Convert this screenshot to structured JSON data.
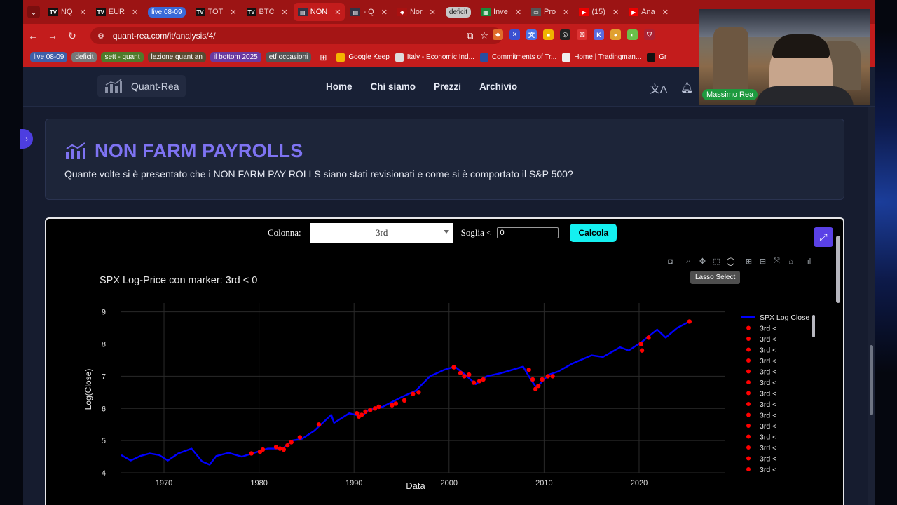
{
  "tabs": [
    {
      "fav": "TV",
      "favcolor": "#111",
      "title": "NQ",
      "pill": false
    },
    {
      "fav": "TV",
      "favcolor": "#111",
      "title": "EUR",
      "pill": false
    },
    {
      "fav": "",
      "favcolor": "",
      "title": "live 08-09",
      "pill": true,
      "pillcolor": "#3a6ad8"
    },
    {
      "fav": "TV",
      "favcolor": "#111",
      "title": "TOT",
      "pill": false
    },
    {
      "fav": "TV",
      "favcolor": "#111",
      "title": "BTC",
      "pill": false
    },
    {
      "fav": "▤",
      "favcolor": "#334",
      "title": "NON",
      "pill": false,
      "active": true
    },
    {
      "fav": "▤",
      "favcolor": "#334",
      "title": "- Q",
      "pill": false
    },
    {
      "fav": "◆",
      "favcolor": "#a11",
      "title": "Nor",
      "pill": false
    },
    {
      "fav": "",
      "favcolor": "",
      "title": "deficit",
      "pill": true,
      "pillcolor": "#c8c8c8"
    },
    {
      "fav": "▦",
      "favcolor": "#1a8a3a",
      "title": "Inve",
      "pill": false
    },
    {
      "fav": "▭",
      "favcolor": "#555",
      "title": "Pro",
      "pill": false
    },
    {
      "fav": "▶",
      "favcolor": "#e00",
      "title": "(15)",
      "pill": false
    },
    {
      "fav": "▶",
      "favcolor": "#e00",
      "title": "Ana",
      "pill": false
    }
  ],
  "address": {
    "url": "quant-rea.com/it/analysis/4/"
  },
  "bookmarks": {
    "pills": [
      {
        "label": "live 08-09",
        "color": "#3f5fa8"
      },
      {
        "label": "deficit",
        "color": "#777"
      },
      {
        "label": "sett - quant",
        "color": "#4f7a2a"
      },
      {
        "label": "lezione quant an",
        "color": "#5a4a30"
      },
      {
        "label": "il bottom 2025",
        "color": "#6a3aa0"
      },
      {
        "label": "etf occasioni",
        "color": "#555"
      }
    ],
    "links": [
      {
        "label": "Google Keep",
        "color": "#f5b400"
      },
      {
        "label": "Italy - Economic Ind...",
        "color": "#ddd"
      },
      {
        "label": "Commitments of Tr...",
        "color": "#2a4fa0"
      },
      {
        "label": "Home | Tradingman...",
        "color": "#eee"
      },
      {
        "label": "Gr",
        "color": "#111"
      }
    ]
  },
  "site": {
    "logo": "Quant-Rea",
    "nav": [
      "Home",
      "Chi siamo",
      "Prezzi",
      "Archivio"
    ]
  },
  "webcam": {
    "name": "Massimo Rea"
  },
  "hero": {
    "title": "NON FARM PAYROLLS",
    "subtitle": "Quante volte si è presentato che i NON FARM PAY ROLLS siano stati revisionati e come si è comportato il S&P 500?"
  },
  "controls": {
    "colonna_label": "Colonna:",
    "colonna_value": "3rd",
    "soglia_label": "Soglia <",
    "soglia_value": "0",
    "calcola": "Calcola"
  },
  "tooltip": "Lasso Select",
  "chart_data": {
    "type": "line",
    "title": "SPX Log-Price con marker: 3rd < 0",
    "xlabel": "Data",
    "ylabel": "Log(Close)",
    "xlim": [
      1965.5,
      2029
    ],
    "ylim": [
      4,
      9.15
    ],
    "xticks": [
      1970,
      1980,
      1990,
      2000,
      2010,
      2020
    ],
    "yticks": [
      4,
      5,
      6,
      7,
      8,
      9
    ],
    "grid": true,
    "legend_position": "right",
    "series": [
      {
        "name": "SPX Log Close",
        "color": "#0000ff",
        "x": [
          1965.5,
          1966.5,
          1967.5,
          1968.5,
          1969.5,
          1970.4,
          1971.5,
          1972.9,
          1974.0,
          1974.8,
          1975.5,
          1976.8,
          1978.2,
          1979.5,
          1980.9,
          1982.5,
          1983.5,
          1984.5,
          1985.8,
          1987.6,
          1987.9,
          1989.5,
          1990.8,
          1991.5,
          1993.0,
          1995.0,
          1996.5,
          1998.0,
          1999.5,
          2000.6,
          2001.7,
          2002.8,
          2004.0,
          2005.5,
          2007.8,
          2008.7,
          2009.2,
          2010.5,
          2011.5,
          2013.0,
          2015.0,
          2016.2,
          2018.0,
          2018.9,
          2020.2,
          2021.9,
          2022.8,
          2024.0,
          2025.3
        ],
        "y": [
          4.55,
          4.38,
          4.52,
          4.6,
          4.55,
          4.38,
          4.6,
          4.75,
          4.35,
          4.25,
          4.52,
          4.62,
          4.5,
          4.62,
          4.75,
          4.75,
          5.0,
          5.05,
          5.3,
          5.8,
          5.55,
          5.85,
          5.75,
          5.95,
          6.05,
          6.35,
          6.55,
          7.0,
          7.2,
          7.3,
          7.05,
          6.75,
          7.0,
          7.1,
          7.3,
          6.85,
          6.65,
          7.05,
          7.15,
          7.4,
          7.65,
          7.6,
          7.9,
          7.8,
          8.05,
          8.45,
          8.2,
          8.5,
          8.7
        ]
      },
      {
        "name": "3rd <",
        "color": "#ff0000",
        "marker": "dot",
        "x": [
          1979.2,
          1980.1,
          1980.4,
          1981.8,
          1982.2,
          1982.6,
          1983.0,
          1983.4,
          1984.3,
          1986.3,
          1990.3,
          1990.5,
          1990.8,
          1991.2,
          1991.7,
          1992.2,
          1992.6,
          1994.0,
          1994.4,
          1995.3,
          1996.2,
          1996.8,
          2000.5,
          2001.2,
          2001.6,
          2002.1,
          2002.6,
          2003.2,
          2003.6,
          2008.4,
          2008.8,
          2009.1,
          2009.4,
          2009.8,
          2010.4,
          2010.9,
          2020.2,
          2020.3,
          2021.0,
          2025.3
        ],
        "y": [
          4.6,
          4.65,
          4.72,
          4.8,
          4.75,
          4.72,
          4.85,
          4.95,
          5.1,
          5.5,
          5.85,
          5.75,
          5.8,
          5.9,
          5.95,
          6.0,
          6.05,
          6.1,
          6.15,
          6.25,
          6.45,
          6.5,
          7.28,
          7.1,
          7.0,
          7.05,
          6.8,
          6.85,
          6.9,
          7.2,
          6.9,
          6.6,
          6.7,
          6.9,
          7.0,
          7.0,
          8.0,
          7.8,
          8.2,
          8.7
        ]
      }
    ],
    "legend_entries": [
      "SPX Log Close",
      "3rd <",
      "3rd <",
      "3rd <",
      "3rd <",
      "3rd <",
      "3rd <",
      "3rd <",
      "3rd <",
      "3rd <",
      "3rd <",
      "3rd <",
      "3rd <",
      "3rd <",
      "3rd <"
    ]
  }
}
